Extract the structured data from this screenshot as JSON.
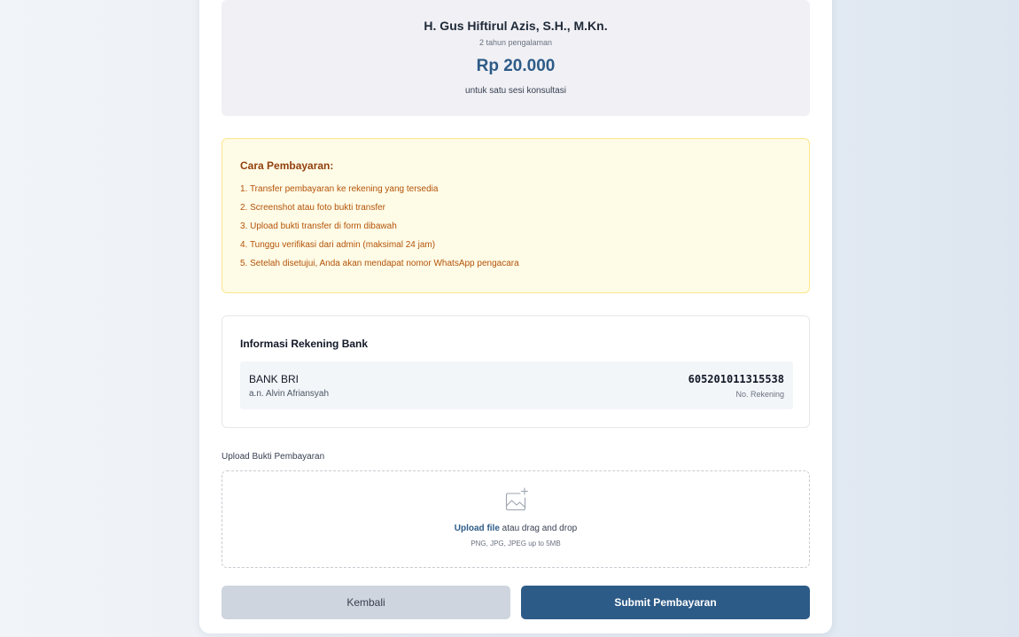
{
  "lawyer": {
    "name": "H. Gus Hiftirul Azis, S.H., M.Kn.",
    "experience": "2 tahun pengalaman",
    "price": "Rp 20.000",
    "price_note": "untuk satu sesi konsultasi"
  },
  "payment_steps": {
    "title": "Cara Pembayaran:",
    "items": [
      "1. Transfer pembayaran ke rekening yang tersedia",
      "2. Screenshot atau foto bukti transfer",
      "3. Upload bukti transfer di form dibawah",
      "4. Tunggu verifikasi dari admin (maksimal 24 jam)",
      "5. Setelah disetujui, Anda akan mendapat nomor WhatsApp pengacara"
    ]
  },
  "bank": {
    "title": "Informasi Rekening Bank",
    "bank_name": "BANK BRI",
    "holder": "a.n. Alvin Afriansyah",
    "account_number": "605201011315538",
    "account_label": "No. Rekening"
  },
  "upload": {
    "label": "Upload Bukti Pembayaran",
    "icon": "image-add-icon",
    "link_text": "Upload file",
    "drag_text": " atau drag and drop",
    "hint": "PNG, JPG, JPEG up to 5MB"
  },
  "buttons": {
    "back": "Kembali",
    "submit": "Submit Pembayaran"
  },
  "colors": {
    "primary": "#2d5b87",
    "warning_bg": "#fefbe6",
    "warning_text": "#b45309",
    "back_button": "#cfd5de"
  }
}
